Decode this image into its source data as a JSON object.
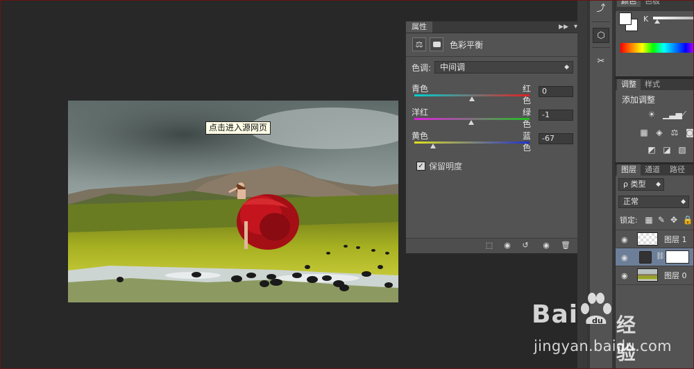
{
  "canvas": {
    "tooltip": "点击进入源网页"
  },
  "properties_panel": {
    "tab_label": "属性",
    "title": "色彩平衡",
    "tone": {
      "label": "色调:",
      "value": "中间调"
    },
    "sliders": [
      {
        "left_label": "青色",
        "right_label": "红色",
        "value": "0",
        "level": 0,
        "gradient": [
          "#00d0d0",
          "#e02020"
        ]
      },
      {
        "left_label": "洋红",
        "right_label": "绿色",
        "value": "-1",
        "level": -1,
        "gradient": [
          "#e020e0",
          "#20c020"
        ]
      },
      {
        "left_label": "黄色",
        "right_label": "蓝色",
        "value": "-67",
        "level": -67,
        "gradient": [
          "#e0e020",
          "#2030d0"
        ]
      }
    ],
    "preserve_luminosity": {
      "label": "保留明度",
      "checked": true
    }
  },
  "color_panel": {
    "tabs": [
      "颜色",
      "色板"
    ],
    "channel_label": "K"
  },
  "adjustments_panel": {
    "tabs": [
      "调整",
      "样式"
    ],
    "title": "添加调整"
  },
  "layers_panel": {
    "tabs": [
      "图层",
      "通道",
      "路径"
    ],
    "filter": "ρ 类型",
    "blend_mode": "正常",
    "lock_label": "锁定:",
    "layers": [
      {
        "name": "图层 1",
        "selected": false
      },
      {
        "name": "",
        "selected": true
      },
      {
        "name": "图层 0",
        "selected": false
      }
    ]
  },
  "watermark": {
    "brand": "Bai",
    "brand2": "经验",
    "url": "jingyan.baidu.com"
  }
}
